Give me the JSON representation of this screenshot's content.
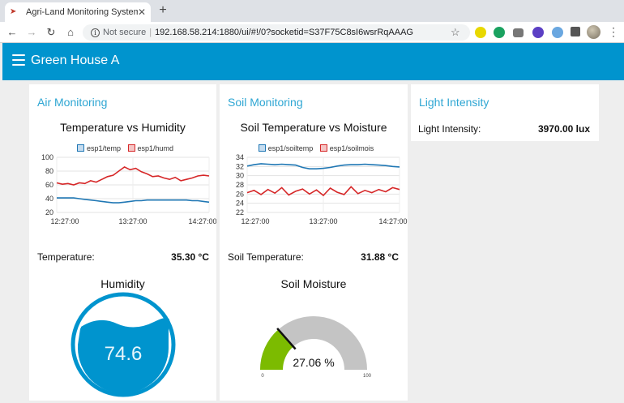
{
  "browser": {
    "tab_title": "Agri-Land Monitoring System",
    "url_security": "Not secure",
    "url": "192.168.58.214:1880/ui/#!/0?socketid=S37F75C8sI6wsrRqAAAG"
  },
  "header": {
    "title": "Green House A"
  },
  "colors": {
    "header": "#0094ce",
    "title_text": "#2ea6d3",
    "series_blue": "#1f77b4",
    "series_red": "#d62728",
    "gauge_green": "#7cbb00",
    "gauge_bg": "#c4c4c4",
    "liquid": "#0094ce"
  },
  "air": {
    "card_title": "Air Monitoring",
    "temperature_label": "Temperature:",
    "temperature_value": "35.30 °C",
    "humidity_title": "Humidity",
    "humidity_value": "74.6"
  },
  "soil": {
    "card_title": "Soil Monitoring",
    "temperature_label": "Soil Temperature:",
    "temperature_value": "31.88 °C",
    "moisture_title": "Soil Moisture",
    "moisture_value": "27.06 %",
    "moisture_level": 27.06,
    "gauge_min": "0",
    "gauge_max": "100"
  },
  "light": {
    "card_title": "Light Intensity",
    "label": "Light Intensity:",
    "value": "3970.00 lux"
  },
  "chart_data": [
    {
      "type": "line",
      "title": "Temperature vs Humidity",
      "x_ticks": [
        "12:27:00",
        "13:27:00",
        "14:27:00"
      ],
      "y_ticks": [
        100,
        80,
        60,
        40,
        20
      ],
      "ylim": [
        20,
        100
      ],
      "series": [
        {
          "name": "esp1/temp",
          "color": "#1f77b4",
          "values": [
            41,
            41,
            41,
            41,
            40,
            39,
            38,
            37,
            36,
            35,
            34,
            34,
            35,
            36,
            37,
            37,
            38,
            38,
            38,
            38,
            38,
            38,
            38,
            38,
            37,
            37,
            36,
            35
          ]
        },
        {
          "name": "esp1/humd",
          "color": "#d62728",
          "values": [
            63,
            61,
            62,
            60,
            63,
            62,
            66,
            64,
            68,
            72,
            74,
            80,
            86,
            82,
            84,
            79,
            76,
            72,
            73,
            70,
            68,
            71,
            66,
            68,
            70,
            73,
            74,
            73
          ]
        }
      ],
      "legend": "top",
      "grid": true
    },
    {
      "type": "line",
      "title": "Soil Temperature vs Moisture",
      "x_ticks": [
        "12:27:00",
        "13:27:00",
        "14:27:00"
      ],
      "y_ticks": [
        34,
        32,
        30,
        28,
        26,
        24,
        22
      ],
      "ylim": [
        22,
        34
      ],
      "series": [
        {
          "name": "esp1/soiltemp",
          "color": "#1f77b4",
          "values": [
            32.1,
            32.4,
            32.6,
            32.5,
            32.4,
            32.5,
            32.4,
            32.3,
            31.8,
            31.5,
            31.5,
            31.6,
            31.8,
            32.1,
            32.3,
            32.4,
            32.4,
            32.5,
            32.4,
            32.3,
            32.2,
            32.0,
            31.9
          ]
        },
        {
          "name": "esp1/soilmois",
          "color": "#d62728",
          "values": [
            26.3,
            26.8,
            25.9,
            27.0,
            26.2,
            27.4,
            25.8,
            26.6,
            27.1,
            26.0,
            26.9,
            25.7,
            27.3,
            26.4,
            25.9,
            27.6,
            26.1,
            26.8,
            26.3,
            27.0,
            26.5,
            27.4,
            27.0
          ]
        }
      ],
      "legend": "top",
      "grid": true
    }
  ]
}
